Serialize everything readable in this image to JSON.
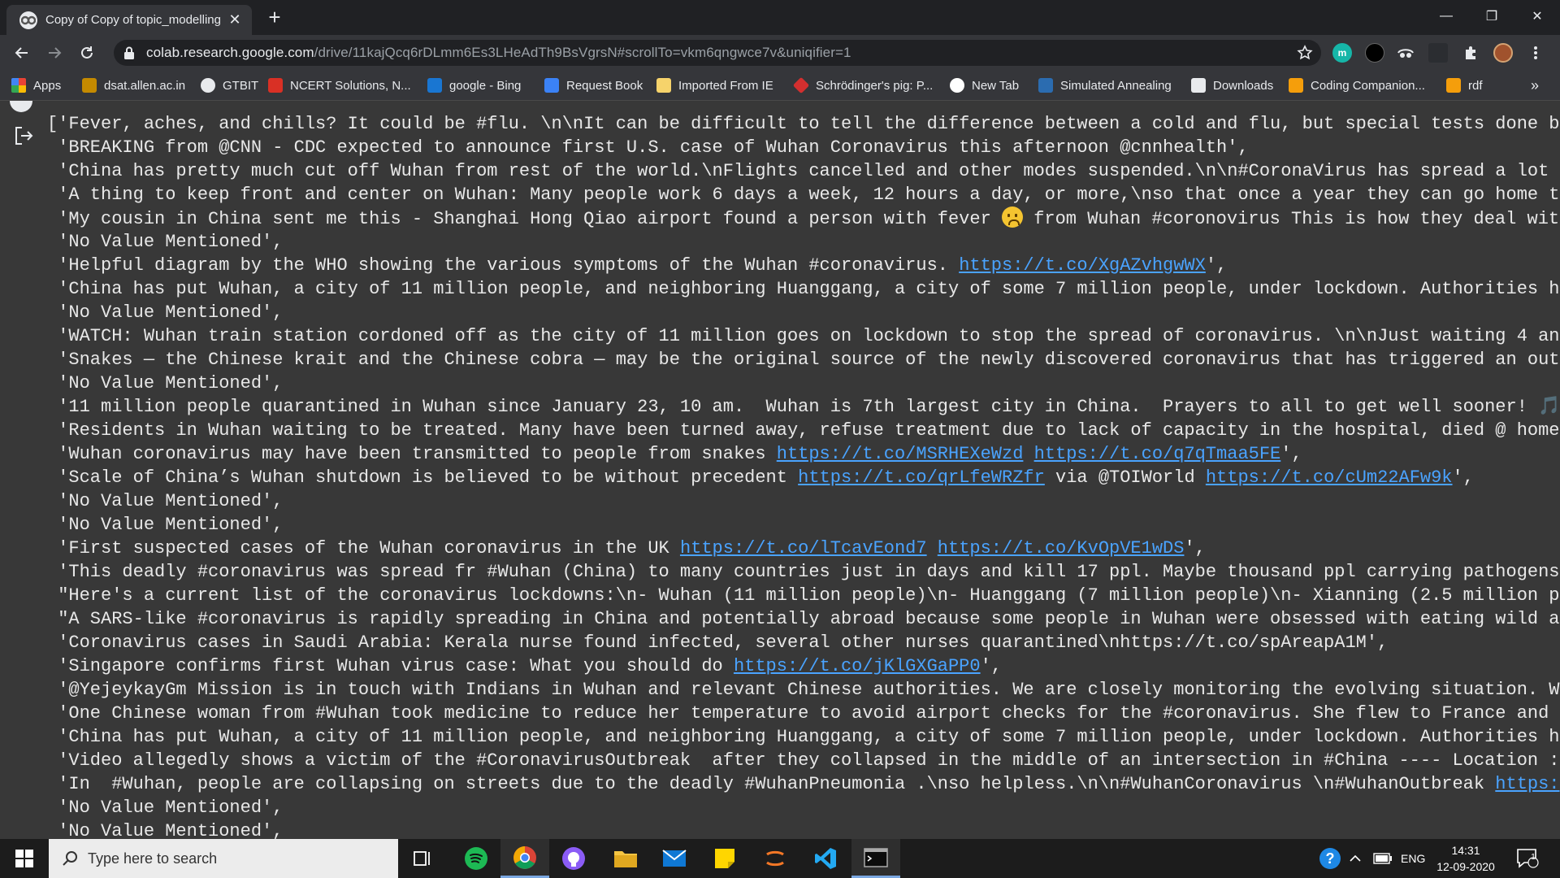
{
  "browser": {
    "tab_title": "Copy of Copy of topic_modelling",
    "tab_close": "✕",
    "new_tab": "+",
    "url_domain": "colab.research.google.com",
    "url_path": "/drive/11kajQcq6rDLmm6Es3LHeAdTh9BsVgrsN#scrollTo=vkm6qngwce7v&uniqifier=1",
    "window_controls": {
      "minimize": "—",
      "restore": "❐",
      "close": "✕"
    },
    "extensions": {
      "m": "m"
    }
  },
  "bookmarks": [
    {
      "label": "Apps",
      "icon": "apps-grid-icon",
      "color": "#4285f4"
    },
    {
      "label": "dsat.allen.ac.in",
      "icon": "allen-icon",
      "color": "#c48a00"
    },
    {
      "label": "GTBIT",
      "icon": "globe-icon",
      "color": "#e8eaed"
    },
    {
      "label": "NCERT Solutions, N...",
      "icon": "ncert-icon",
      "color": "#d93025"
    },
    {
      "label": "google - Bing",
      "icon": "bing-icon",
      "color": "#1976d2"
    },
    {
      "label": "Request Book",
      "icon": "z-library-icon",
      "color": "#3b82f6"
    },
    {
      "label": "Imported From IE",
      "icon": "folder-icon",
      "color": "#f6d36b"
    },
    {
      "label": "Schrödinger's pig: P...",
      "icon": "diamond-icon",
      "color": "#d32f2f"
    },
    {
      "label": "New Tab",
      "icon": "new-tab-icon",
      "color": "#ffffff"
    },
    {
      "label": "Simulated Annealing",
      "icon": "graph-icon",
      "color": "#2b6cb0"
    },
    {
      "label": "Downloads",
      "icon": "download-icon",
      "color": "#e8eaed"
    },
    {
      "label": "Coding Companion...",
      "icon": "coding-icon",
      "color": "#f59e0b"
    },
    {
      "label": "rdf",
      "icon": "rdf-icon",
      "color": "#f59e0b"
    }
  ],
  "bookmarks_more": "»",
  "output": {
    "lines": [
      [
        {
          "t": "['Fever, aches, and chills? It could be #flu. \\n\\nIt can be difficult to tell the difference between a cold and flu, but special tests done by"
        }
      ],
      [
        {
          "t": " 'BREAKING from @CNN - CDC expected to announce first U.S. case of Wuhan Coronavirus this afternoon @cnnhealth',"
        }
      ],
      [
        {
          "t": " 'China has pretty much cut off Wuhan from rest of the world.\\nFlights cancelled and other modes suspended.\\n\\n#CoronaVirus has spread a lot"
        }
      ],
      [
        {
          "t": " 'A thing to keep front and center on Wuhan: Many people work 6 days a week, 12 hours a day, or more,\\nso that once a year they can go home to"
        }
      ],
      [
        {
          "t": " 'My cousin in China sent me this - Shanghai Hong Qiao airport found a person with fever "
        },
        {
          "e": "worried-face-emoji"
        },
        {
          "t": " from Wuhan #coronovirus This is how they deal with"
        }
      ],
      [
        {
          "t": " 'No Value Mentioned',"
        }
      ],
      [
        {
          "t": " 'Helpful diagram by the WHO showing the various symptoms of the Wuhan #coronavirus. "
        },
        {
          "l": "https://t.co/XgAZvhgwWX"
        },
        {
          "t": "',"
        }
      ],
      [
        {
          "t": " 'China has put Wuhan, a city of 11 million people, and neighboring Huanggang, a city of some 7 million people, under lockdown. Authorities h"
        }
      ],
      [
        {
          "t": " 'No Value Mentioned',"
        }
      ],
      [
        {
          "t": " 'WATCH: Wuhan train station cordoned off as the city of 11 million goes on lockdown to stop the spread of coronavirus. \\n\\nJust waiting 4 an"
        }
      ],
      [
        {
          "t": " 'Snakes — the Chinese krait and the Chinese cobra — may be the original source of the newly discovered coronavirus that has triggered an out"
        }
      ],
      [
        {
          "t": " 'No Value Mentioned',"
        }
      ],
      [
        {
          "t": " '11 million people quarantined in Wuhan since January 23, 10 am.  Wuhan is 7th largest city in China.  Prayers to all to get well sooner! 🎵"
        }
      ],
      [
        {
          "t": " 'Residents in Wuhan waiting to be treated. Many have been turned away, refuse treatment due to lack of capacity in the hospital, died @ home"
        }
      ],
      [
        {
          "t": " 'Wuhan coronavirus may have been transmitted to people from snakes "
        },
        {
          "l": "https://t.co/MSRHEXeWzd"
        },
        {
          "t": " "
        },
        {
          "l": "https://t.co/q7qTmaa5FE"
        },
        {
          "t": "',"
        }
      ],
      [
        {
          "t": " 'Scale of China’s Wuhan shutdown is believed to be without precedent "
        },
        {
          "l": "https://t.co/qrLfeWRZfr"
        },
        {
          "t": " via @TOIWorld "
        },
        {
          "l": "https://t.co/cUm22AFw9k"
        },
        {
          "t": "',"
        }
      ],
      [
        {
          "t": " 'No Value Mentioned',"
        }
      ],
      [
        {
          "t": " 'No Value Mentioned',"
        }
      ],
      [
        {
          "t": " 'First suspected cases of the Wuhan coronavirus in the UK "
        },
        {
          "l": "https://t.co/lTcavEond7"
        },
        {
          "t": " "
        },
        {
          "l": "https://t.co/KvOpVE1wDS"
        },
        {
          "t": "',"
        }
      ],
      [
        {
          "t": " 'This deadly #coronavirus was spread fr #Wuhan (China) to many countries just in days and kill 17 ppl. Maybe thousand ppl carrying pathogens"
        }
      ],
      [
        {
          "t": " \"Here's a current list of the coronavirus lockdowns:\\n- Wuhan (11 million people)\\n- Huanggang (7 million people)\\n- Xianning (2.5 million p"
        }
      ],
      [
        {
          "t": " \"A SARS-like #coronavirus is rapidly spreading in China and potentially abroad because some people in Wuhan were obsessed with eating wild a"
        }
      ],
      [
        {
          "t": " 'Coronavirus cases in Saudi Arabia: Kerala nurse found infected, several other nurses quarantined\\nhttps://t.co/spAreapA1M',"
        }
      ],
      [
        {
          "t": " 'Singapore confirms first Wuhan virus case: What you should do "
        },
        {
          "l": "https://t.co/jKlGXGaPP0"
        },
        {
          "t": "',"
        }
      ],
      [
        {
          "t": " '@YejeykayGm Mission is in touch with Indians in Wuhan and relevant Chinese authorities. We are closely monitoring the evolving situation. W"
        }
      ],
      [
        {
          "t": " 'One Chinese woman from #Wuhan took medicine to reduce her temperature to avoid airport checks for the #coronavirus. She flew to France and"
        }
      ],
      [
        {
          "t": " 'China has put Wuhan, a city of 11 million people, and neighboring Huanggang, a city of some 7 million people, under lockdown. Authorities h"
        }
      ],
      [
        {
          "t": " 'Video allegedly shows a victim of the #CoronavirusOutbreak  after they collapsed in the middle of an intersection in #China ---- Location :"
        }
      ],
      [
        {
          "t": " 'In  #Wuhan, people are collapsing on streets due to the deadly #WuhanPneumonia .\\nso helpless.\\n\\n#WuhanCoronavirus \\n#WuhanOutbreak "
        },
        {
          "l": "https:"
        }
      ],
      [
        {
          "t": " 'No Value Mentioned',"
        }
      ],
      [
        {
          "t": " 'No Value Mentioned',"
        }
      ]
    ]
  },
  "taskbar": {
    "search_placeholder": "Type here to search",
    "lang": "ENG",
    "time": "14:31",
    "date": "12-09-2020",
    "notifications": "1"
  },
  "colors": {
    "link": "#4aa3ff",
    "spotify": "#1db954",
    "vscode": "#23a9f2"
  }
}
